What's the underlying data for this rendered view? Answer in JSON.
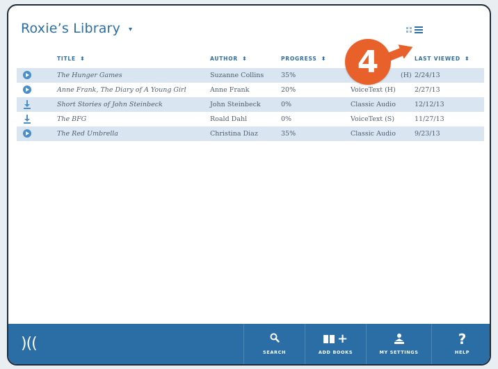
{
  "library": {
    "title": "Roxie’s Library",
    "caret": "▾"
  },
  "view_toggle": {
    "grid_icon": "grid-view-icon",
    "list_icon": "list-view-icon"
  },
  "columns": {
    "title": "TITLE",
    "author": "AUTHOR",
    "progress": "PROGRESS",
    "last_viewed": "LAST VIEWED",
    "sort_glyph": "⬍"
  },
  "books": [
    {
      "icon": "play-icon",
      "title": "The Hunger Games",
      "author": "Suzanne Collins",
      "progress": "35%",
      "format": "(H)",
      "last_viewed": "2/24/13"
    },
    {
      "icon": "play-icon",
      "title": "Anne Frank, The Diary of A Young Girl",
      "author": "Anne Frank",
      "progress": "20%",
      "format": "VoiceText (H)",
      "last_viewed": "2/27/13"
    },
    {
      "icon": "download-icon",
      "title": "Short Stories of John Steinbeck",
      "author": "John Steinbeck",
      "progress": "0%",
      "format": "Classic Audio",
      "last_viewed": "12/12/13"
    },
    {
      "icon": "download-icon",
      "title": "The BFG",
      "author": "Roald Dahl",
      "progress": "0%",
      "format": "VoiceText (S)",
      "last_viewed": "11/27/13"
    },
    {
      "icon": "play-icon",
      "title": "The Red Umbrella",
      "author": "Christina Diaz",
      "progress": "35%",
      "format": "Classic Audio",
      "last_viewed": "9/23/13"
    }
  ],
  "callout": {
    "number": "4"
  },
  "footer": {
    "logo": ")((",
    "search": {
      "label": "SEARCH",
      "icon": "search-icon"
    },
    "add_books": {
      "label": "ADD BOOKS",
      "icon": "add-books-icon"
    },
    "my_settings": {
      "label": "MY SETTINGS",
      "icon": "settings-icon"
    },
    "help": {
      "label": "HELP",
      "icon": "help-icon",
      "glyph": "?"
    }
  },
  "colors": {
    "brand_blue": "#2b6ea6",
    "row_shade": "#d9e6f1",
    "callout_orange": "#e8612a"
  }
}
